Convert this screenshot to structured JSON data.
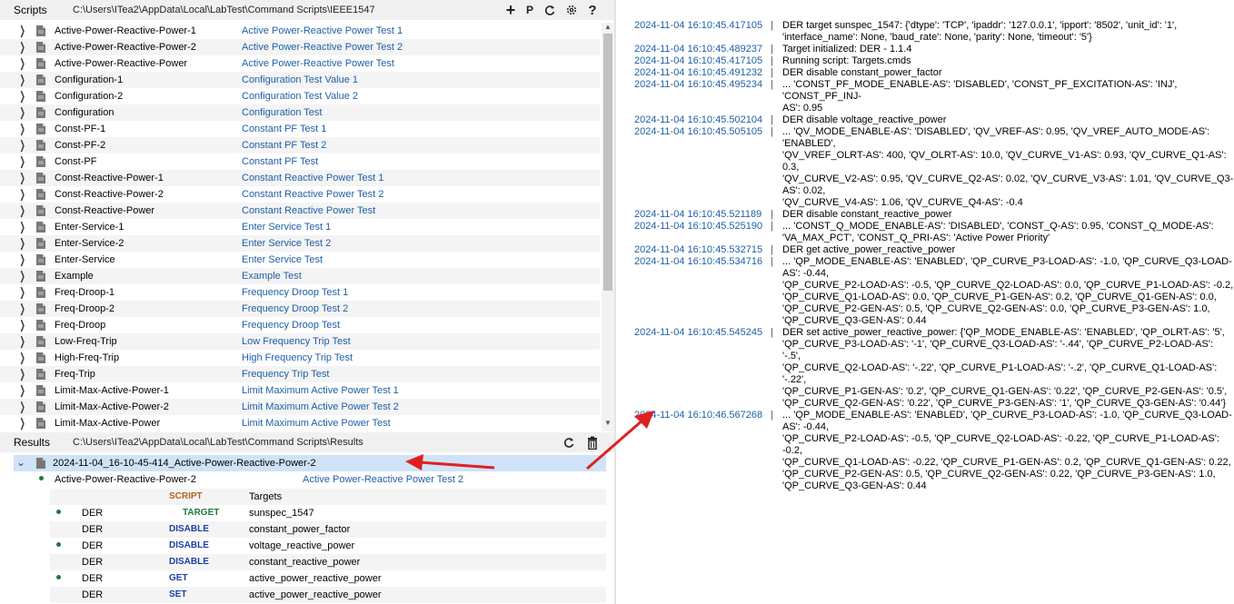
{
  "scripts_panel": {
    "title": "Scripts",
    "path": "C:\\Users\\ITea2\\AppData\\Local\\LabTest\\Command Scripts\\IEEE1547",
    "buttons": {
      "add": "+",
      "p": "P"
    },
    "items": [
      {
        "name": "Active-Power-Reactive-Power-1",
        "desc": "Active Power-Reactive Power Test 1"
      },
      {
        "name": "Active-Power-Reactive-Power-2",
        "desc": "Active Power-Reactive Power Test 2"
      },
      {
        "name": "Active-Power-Reactive-Power",
        "desc": "Active Power-Reactive Power Test"
      },
      {
        "name": "Configuration-1",
        "desc": "Configuration Test Value 1"
      },
      {
        "name": "Configuration-2",
        "desc": "Configuration Test Value 2"
      },
      {
        "name": "Configuration",
        "desc": "Configuration Test"
      },
      {
        "name": "Const-PF-1",
        "desc": "Constant PF Test 1"
      },
      {
        "name": "Const-PF-2",
        "desc": "Constant PF Test 2"
      },
      {
        "name": "Const-PF",
        "desc": "Constant PF Test"
      },
      {
        "name": "Const-Reactive-Power-1",
        "desc": "Constant Reactive Power Test 1"
      },
      {
        "name": "Const-Reactive-Power-2",
        "desc": "Constant Reactive Power Test 2"
      },
      {
        "name": "Const-Reactive-Power",
        "desc": "Constant Reactive Power Test"
      },
      {
        "name": "Enter-Service-1",
        "desc": "Enter Service Test 1"
      },
      {
        "name": "Enter-Service-2",
        "desc": "Enter Service Test 2"
      },
      {
        "name": "Enter-Service",
        "desc": "Enter Service Test"
      },
      {
        "name": "Example",
        "desc": "Example Test"
      },
      {
        "name": "Freq-Droop-1",
        "desc": "Frequency Droop Test 1"
      },
      {
        "name": "Freq-Droop-2",
        "desc": "Frequency Droop Test 2"
      },
      {
        "name": "Freq-Droop",
        "desc": "Frequency Droop Test"
      },
      {
        "name": "Low-Freq-Trip",
        "desc": "Low Frequency Trip Test"
      },
      {
        "name": "High-Freq-Trip",
        "desc": "High Frequency Trip Test"
      },
      {
        "name": "Freq-Trip",
        "desc": "Frequency Trip Test"
      },
      {
        "name": "Limit-Max-Active-Power-1",
        "desc": "Limit Maximum Active Power Test 1"
      },
      {
        "name": "Limit-Max-Active-Power-2",
        "desc": "Limit Maximum Active Power Test 2"
      },
      {
        "name": "Limit-Max-Active-Power",
        "desc": "Limit Maximum Active Power Test"
      }
    ]
  },
  "results_panel": {
    "title": "Results",
    "path": "C:\\Users\\ITea2\\AppData\\Local\\LabTest\\Command Scripts\\Results",
    "result_file": "2024-11-04_16-10-45-414_Active-Power-Reactive-Power-2",
    "script_name": "Active-Power-Reactive-Power-2",
    "script_desc": "Active Power-Reactive Power Test 2",
    "script_label": "SCRIPT",
    "script_value": "Targets",
    "commands": [
      {
        "target": "DER",
        "cmd": "TARGET",
        "arg": "sunspec_1547",
        "color": "#1e7a3a"
      },
      {
        "target": "DER",
        "cmd": "DISABLE",
        "arg": "constant_power_factor",
        "color": "#1f3fa6"
      },
      {
        "target": "DER",
        "cmd": "DISABLE",
        "arg": "voltage_reactive_power",
        "color": "#1f3fa6"
      },
      {
        "target": "DER",
        "cmd": "DISABLE",
        "arg": "constant_reactive_power",
        "color": "#1f3fa6"
      },
      {
        "target": "DER",
        "cmd": "GET",
        "arg": "active_power_reactive_power",
        "color": "#1f3fa6"
      },
      {
        "target": "DER",
        "cmd": "SET",
        "arg": "active_power_reactive_power",
        "color": "#1f3fa6"
      }
    ]
  },
  "log": {
    "separator": "|",
    "entries": [
      {
        "ts": "2024-11-04 16:10:45.417105",
        "msg": "DER target sunspec_1547: {'dtype': 'TCP', 'ipaddr': '127.0.0.1', 'ipport': '8502', 'unit_id': '1',\n'interface_name': None, 'baud_rate': None, 'parity': None, 'timeout': '5'}"
      },
      {
        "ts": "2024-11-04 16:10:45.489237",
        "msg": "Target initialized: DER - 1.1.4"
      },
      {
        "ts": "2024-11-04 16:10:45.417105",
        "msg": "Running script: Targets.cmds"
      },
      {
        "ts": "2024-11-04 16:10:45.491232",
        "msg": "DER disable constant_power_factor"
      },
      {
        "ts": "2024-11-04 16:10:45.495234",
        "msg": "... 'CONST_PF_MODE_ENABLE-AS': 'DISABLED', 'CONST_PF_EXCITATION-AS': 'INJ', 'CONST_PF_INJ-\nAS': 0.95"
      },
      {
        "ts": "2024-11-04 16:10:45.502104",
        "msg": "DER disable voltage_reactive_power"
      },
      {
        "ts": "2024-11-04 16:10:45.505105",
        "msg": "... 'QV_MODE_ENABLE-AS': 'DISABLED', 'QV_VREF-AS': 0.95, 'QV_VREF_AUTO_MODE-AS': 'ENABLED',\n'QV_VREF_OLRT-AS': 400, 'QV_OLRT-AS': 10.0, 'QV_CURVE_V1-AS': 0.93, 'QV_CURVE_Q1-AS': 0.3,\n'QV_CURVE_V2-AS': 0.95, 'QV_CURVE_Q2-AS': 0.02, 'QV_CURVE_V3-AS': 1.01, 'QV_CURVE_Q3-AS': 0.02,\n'QV_CURVE_V4-AS': 1.06, 'QV_CURVE_Q4-AS': -0.4"
      },
      {
        "ts": "2024-11-04 16:10:45.521189",
        "msg": "DER disable constant_reactive_power"
      },
      {
        "ts": "2024-11-04 16:10:45.525190",
        "msg": "... 'CONST_Q_MODE_ENABLE-AS': 'DISABLED', 'CONST_Q-AS': 0.95, 'CONST_Q_MODE-AS':\n'VA_MAX_PCT', 'CONST_Q_PRI-AS': 'Active Power Priority'"
      },
      {
        "ts": "2024-11-04 16:10:45.532715",
        "msg": "DER get active_power_reactive_power"
      },
      {
        "ts": "2024-11-04 16:10:45.534716",
        "msg": "... 'QP_MODE_ENABLE-AS': 'ENABLED', 'QP_CURVE_P3-LOAD-AS': -1.0, 'QP_CURVE_Q3-LOAD-AS': -0.44,\n'QP_CURVE_P2-LOAD-AS': -0.5, 'QP_CURVE_Q2-LOAD-AS': 0.0, 'QP_CURVE_P1-LOAD-AS': -0.2,\n'QP_CURVE_Q1-LOAD-AS': 0.0, 'QP_CURVE_P1-GEN-AS': 0.2, 'QP_CURVE_Q1-GEN-AS': 0.0,\n'QP_CURVE_P2-GEN-AS': 0.5, 'QP_CURVE_Q2-GEN-AS': 0.0, 'QP_CURVE_P3-GEN-AS': 1.0,\n'QP_CURVE_Q3-GEN-AS': 0.44"
      },
      {
        "ts": "2024-11-04 16:10:45.545245",
        "msg": "DER set active_power_reactive_power: {'QP_MODE_ENABLE-AS': 'ENABLED', 'QP_OLRT-AS': '5',\n'QP_CURVE_P3-LOAD-AS': '-1', 'QP_CURVE_Q3-LOAD-AS': '-.44', 'QP_CURVE_P2-LOAD-AS': '-.5',\n'QP_CURVE_Q2-LOAD-AS': '-.22', 'QP_CURVE_P1-LOAD-AS': '-.2', 'QP_CURVE_Q1-LOAD-AS': '-.22',\n'QP_CURVE_P1-GEN-AS': '0.2', 'QP_CURVE_Q1-GEN-AS': '0.22', 'QP_CURVE_P2-GEN-AS': '0.5',\n'QP_CURVE_Q2-GEN-AS': '0.22', 'QP_CURVE_P3-GEN-AS': '1', 'QP_CURVE_Q3-GEN-AS': '0.44'}"
      },
      {
        "ts": "2024-11-04 16:10:46.567268",
        "msg": "... 'QP_MODE_ENABLE-AS': 'ENABLED', 'QP_CURVE_P3-LOAD-AS': -1.0, 'QP_CURVE_Q3-LOAD-AS': -0.44,\n'QP_CURVE_P2-LOAD-AS': -0.5, 'QP_CURVE_Q2-LOAD-AS': -0.22, 'QP_CURVE_P1-LOAD-AS': -0.2,\n'QP_CURVE_Q1-LOAD-AS': -0.22, 'QP_CURVE_P1-GEN-AS': 0.2, 'QP_CURVE_Q1-GEN-AS': 0.22,\n'QP_CURVE_P2-GEN-AS': 0.5, 'QP_CURVE_Q2-GEN-AS': 0.22, 'QP_CURVE_P3-GEN-AS': 1.0,\n'QP_CURVE_Q3-GEN-AS': 0.44"
      }
    ]
  },
  "colors": {
    "link": "#1f5fa6",
    "selection": "#cfe3f7",
    "annotation_arrow": "#e02020",
    "bullet": "#1e7a3a"
  }
}
